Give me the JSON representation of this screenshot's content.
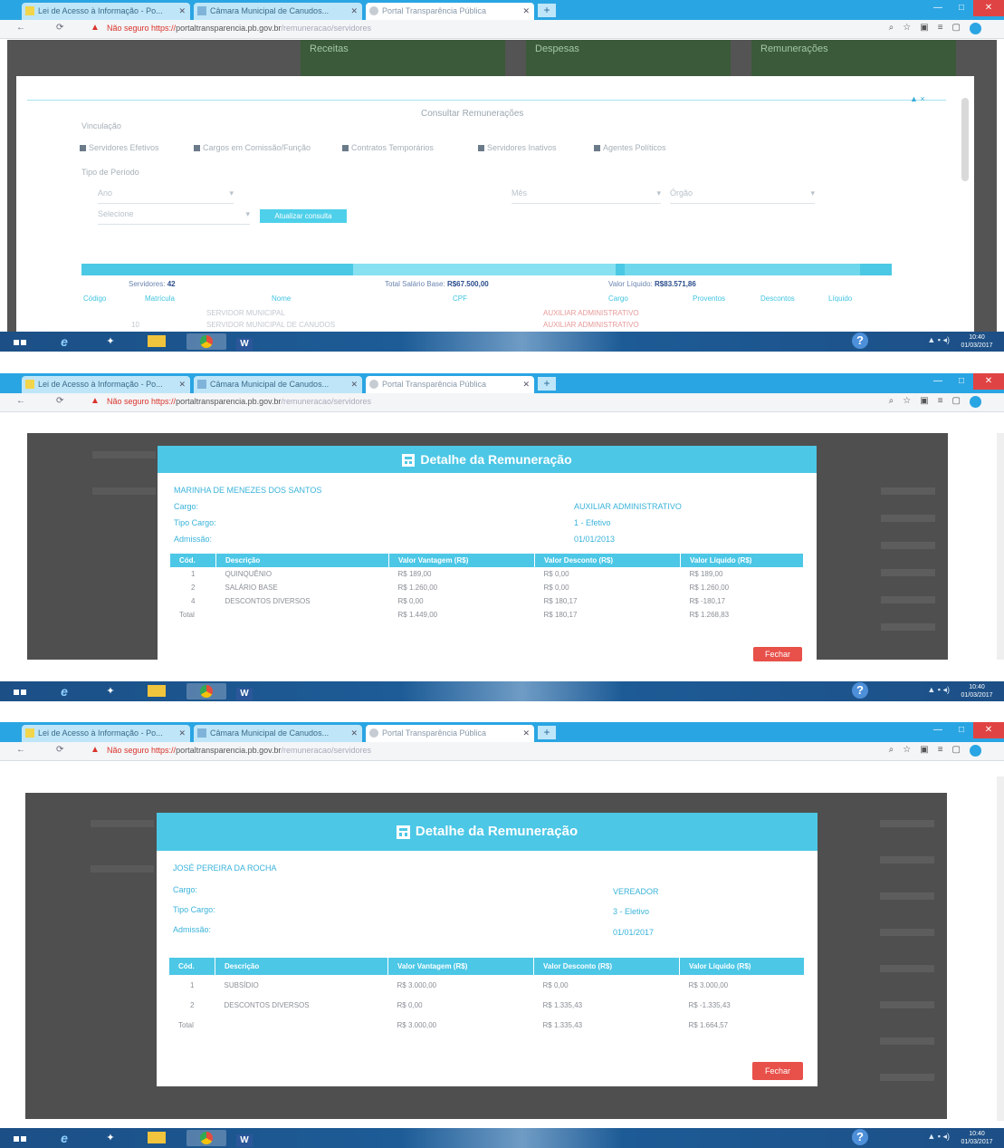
{
  "browser": {
    "tabs": [
      {
        "label": "Lei de Acesso à Informação - Po..."
      },
      {
        "label": "Câmara Municipal de Canudos..."
      },
      {
        "label": "Portal Transparência Pública"
      }
    ],
    "new_tab": "+",
    "security_label": "Não seguro",
    "url_scheme": "https://",
    "url_domain": "portaltransparencia.pb.gov.br",
    "url_path": "/remuneracao/servidores",
    "window_controls": {
      "minimize": "—",
      "maximize": "□",
      "close": "✕"
    },
    "nav": {
      "back": "←",
      "reload": "⟳"
    }
  },
  "shot1": {
    "tiles": [
      {
        "label": "Receitas"
      },
      {
        "label": "Despesas"
      },
      {
        "label": "Remunerações"
      }
    ],
    "maximize": "▲ ×",
    "page_title": "Consultar Remunerações",
    "filter_heading": "Vinculação",
    "checkboxes": [
      {
        "label": "Servidores Efetivos"
      },
      {
        "label": "Cargos em Comissão/Função"
      },
      {
        "label": "Contratos Temporários"
      },
      {
        "label": "Servidores Inativos"
      },
      {
        "label": "Agentes Políticos"
      }
    ],
    "period_heading": "Tipo de Período",
    "select_year": "Ano",
    "select_month": "Mês",
    "select_org": "Órgão",
    "select_extra": "Selecione",
    "atualizar_button": "Atualizar consulta",
    "summary_count_label": "Servidores:",
    "summary_count": "42",
    "summary_base_label": "Total Salário Base:",
    "summary_base": "R$67.500,00",
    "summary_liquido_label": "Valor Líquido:",
    "summary_liquido": "R$83.571,86",
    "table_headers": [
      "Código",
      "Matrícula",
      "Nome",
      "CPF",
      "Cargo",
      "Proventos",
      "Descontos",
      "Líquido"
    ],
    "rows": [
      [
        "",
        "",
        "SERVIDOR MUNICIPAL",
        "",
        "AUXILIAR ADMINISTRATIVO",
        "",
        "",
        ""
      ],
      [
        "10",
        "",
        "SERVIDOR MUNICIPAL DE CANUDOS",
        "",
        "AUXILIAR ADMINISTRATIVO",
        "",
        "",
        ""
      ]
    ]
  },
  "shot2": {
    "modal_title": "Detalhe da Remuneração",
    "person": "MARINHA DE MENEZES DOS SANTOS",
    "fields": [
      {
        "label": "Cargo:",
        "value": "AUXILIAR ADMINISTRATIVO"
      },
      {
        "label": "Tipo Cargo:",
        "value": "1 - Efetivo"
      },
      {
        "label": "Admissão:",
        "value": "01/01/2013"
      }
    ],
    "headers": [
      "Cód.",
      "Descrição",
      "Valor Vantagem (R$)",
      "Valor Desconto (R$)",
      "Valor Líquido (R$)"
    ],
    "rows": [
      [
        "1",
        "QUINQUÊNIO",
        "R$ 189,00",
        "R$ 0,00",
        "R$ 189,00"
      ],
      [
        "2",
        "SALÁRIO BASE",
        "R$ 1.260,00",
        "R$ 0,00",
        "R$ 1.260,00"
      ],
      [
        "4",
        "DESCONTOS DIVERSOS",
        "R$ 0,00",
        "R$ 180,17",
        "R$ -180,17"
      ],
      [
        "Total",
        "",
        "R$ 1.449,00",
        "R$ 180,17",
        "R$ 1.268,83"
      ]
    ],
    "close_button": "Fechar"
  },
  "shot3": {
    "modal_title": "Detalhe da Remuneração",
    "person": "JOSÉ PEREIRA DA ROCHA",
    "fields": [
      {
        "label": "Cargo:",
        "value": "VEREADOR"
      },
      {
        "label": "Tipo Cargo:",
        "value": "3 - Eletivo"
      },
      {
        "label": "Admissão:",
        "value": "01/01/2017"
      }
    ],
    "headers": [
      "Cód.",
      "Descrição",
      "Valor Vantagem (R$)",
      "Valor Desconto (R$)",
      "Valor Líquido (R$)"
    ],
    "rows": [
      [
        "1",
        "SUBSÍDIO",
        "R$ 3.000,00",
        "R$ 0,00",
        "R$ 3.000,00"
      ],
      [
        "2",
        "DESCONTOS DIVERSOS",
        "R$ 0,00",
        "R$ 1.335,43",
        "R$ -1.335,43"
      ],
      [
        "Total",
        "",
        "R$ 3.000,00",
        "R$ 1.335,43",
        "R$ 1.664,57"
      ]
    ],
    "close_button": "Fechar"
  },
  "taskbar": {
    "help": "?",
    "tray": "▲ ▪ ◂)",
    "clock_time": "10:40",
    "clock_date": "01/03/2017"
  },
  "colors": {
    "accent": "#4cc7e6",
    "danger": "#e8504a",
    "chrome_blue": "#2aa5e3",
    "overlay": "#4f4f4f"
  }
}
